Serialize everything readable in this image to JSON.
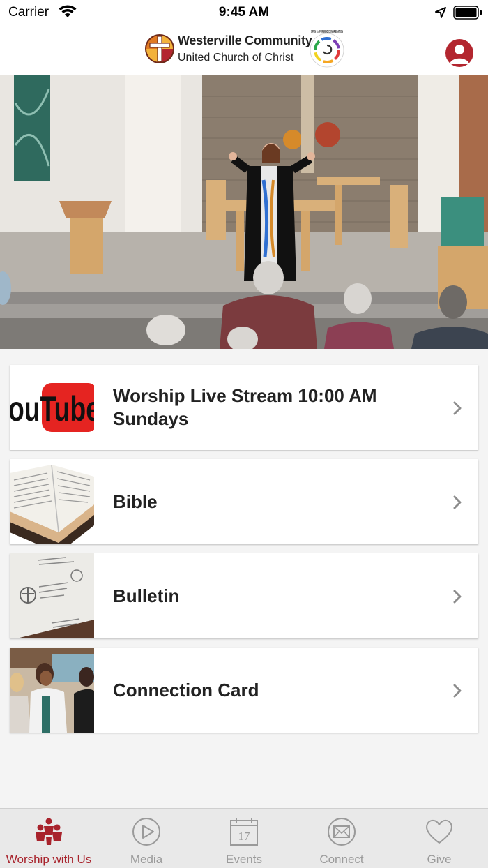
{
  "status_bar": {
    "carrier": "Carrier",
    "time": "9:45 AM"
  },
  "header": {
    "logo_name": "Westerville Community",
    "logo_subtitle": "United Church of Christ",
    "logo_badge_text": "OPEN & AFFIRMING CONGREGATION"
  },
  "menu": [
    {
      "label": "Worship Live Stream 10:00 AM Sundays",
      "thumb_text": "ouTube"
    },
    {
      "label": "Bible"
    },
    {
      "label": "Bulletin"
    },
    {
      "label": "Connection Card"
    }
  ],
  "tabs": [
    {
      "label": "Worship with Us",
      "icon": "people-icon",
      "active": true
    },
    {
      "label": "Media",
      "icon": "play-icon"
    },
    {
      "label": "Events",
      "icon": "calendar-icon",
      "icon_text": "17"
    },
    {
      "label": "Connect",
      "icon": "mail-icon"
    },
    {
      "label": "Give",
      "icon": "heart-icon"
    }
  ],
  "colors": {
    "accent": "#a8232c",
    "inactive": "#9a9a9a",
    "card_bg": "#ffffff",
    "page_bg": "#f4f4f4"
  }
}
